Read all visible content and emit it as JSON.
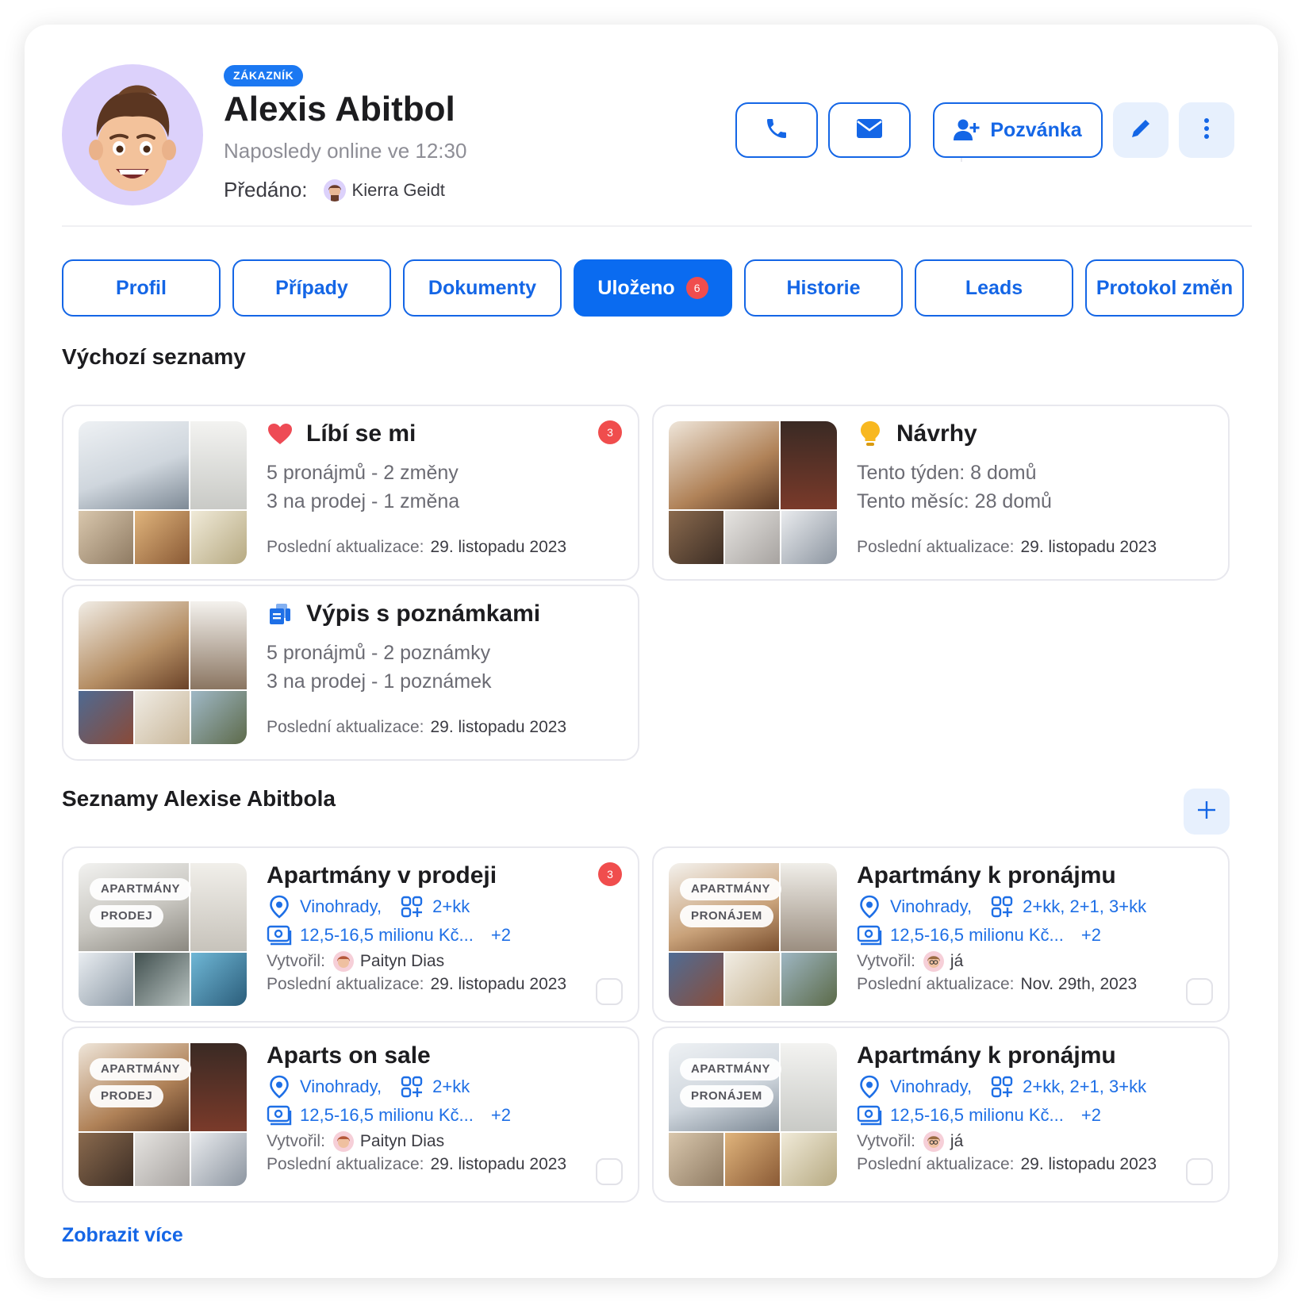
{
  "profile": {
    "role_badge": "ZÁKAZNÍK",
    "name": "Alexis Abitbol",
    "last_online": "Naposledy online ve 12:30",
    "assigned_label": "Předáno:",
    "assigned_to": "Kierra Geidt"
  },
  "actions": {
    "invite_label": "Pozvánka",
    "icons": [
      "phone-icon",
      "mail-icon",
      "add-user-icon",
      "pencil-icon",
      "more-vertical-icon"
    ]
  },
  "tabs": [
    {
      "label": "Profil"
    },
    {
      "label": "Případy"
    },
    {
      "label": "Dokumenty"
    },
    {
      "label": "Uloženo",
      "count": "6",
      "active": true
    },
    {
      "label": "Historie"
    },
    {
      "label": "Leads"
    },
    {
      "label": "Protokol změn"
    }
  ],
  "default_lists": {
    "title": "Výchozí seznamy",
    "update_label": "Poslední aktualizace:",
    "cards": [
      {
        "title": "Líbí se mi",
        "icon": "heart-icon",
        "line1": "5 pronájmů - 2 změny",
        "line2": "3 na prodej - 1 změna",
        "updated": "29. listopadu 2023",
        "badge": "3"
      },
      {
        "title": "Návrhy",
        "icon": "lightbulb-icon",
        "line1": "Tento týden: 8 domů",
        "line2": "Tento měsíc: 28 domů",
        "updated": "29. listopadu 2023"
      },
      {
        "title": "Výpis s poznámkami",
        "icon": "notes-icon",
        "line1": "5 pronájmů - 2 poznámky",
        "line2": "3 na prodej - 1 poznámek",
        "updated": "29. listopadu 2023"
      }
    ]
  },
  "user_lists": {
    "title": "Seznamy Alexise Abitbola",
    "created_label": "Vytvořil:",
    "update_label": "Poslední aktualizace:",
    "cards": [
      {
        "title": "Apartmány v prodeji",
        "pill1": "APARTMÁNY",
        "pill2": "PRODEJ",
        "location": "Vinohrady,",
        "layout": "2+kk",
        "price": "12,5-16,5 milionu Kč...",
        "extra": "+2",
        "creator": "Paityn Dias",
        "updated": "29. listopadu 2023",
        "badge": "3"
      },
      {
        "title": "Apartmány k pronájmu",
        "pill1": "APARTMÁNY",
        "pill2": "PRONÁJEM",
        "location": "Vinohrady,",
        "layout": "2+kk, 2+1, 3+kk",
        "price": "12,5-16,5 milionu Kč...",
        "extra": "+2",
        "creator": "já",
        "updated": "Nov. 29th, 2023"
      },
      {
        "title": "Aparts on sale",
        "pill1": "APARTMÁNY",
        "pill2": "PRODEJ",
        "location": "Vinohrady,",
        "layout": "2+kk",
        "price": "12,5-16,5 milionu Kč...",
        "extra": "+2",
        "creator": "Paityn Dias",
        "updated": "29. listopadu 2023"
      },
      {
        "title": "Apartmány k pronájmu",
        "pill1": "APARTMÁNY",
        "pill2": "PRONÁJEM",
        "location": "Vinohrady,",
        "layout": "2+kk, 2+1, 3+kk",
        "price": "12,5-16,5 milionu Kč...",
        "extra": "+2",
        "creator": "já",
        "updated": "29. listopadu 2023"
      }
    ],
    "show_more": "Zobrazit více"
  },
  "colors": {
    "accent": "#1466e6",
    "active_tab": "#0a6bf0",
    "badge_red": "#f04d4d",
    "avatar_bg": "#dcd1fb"
  }
}
